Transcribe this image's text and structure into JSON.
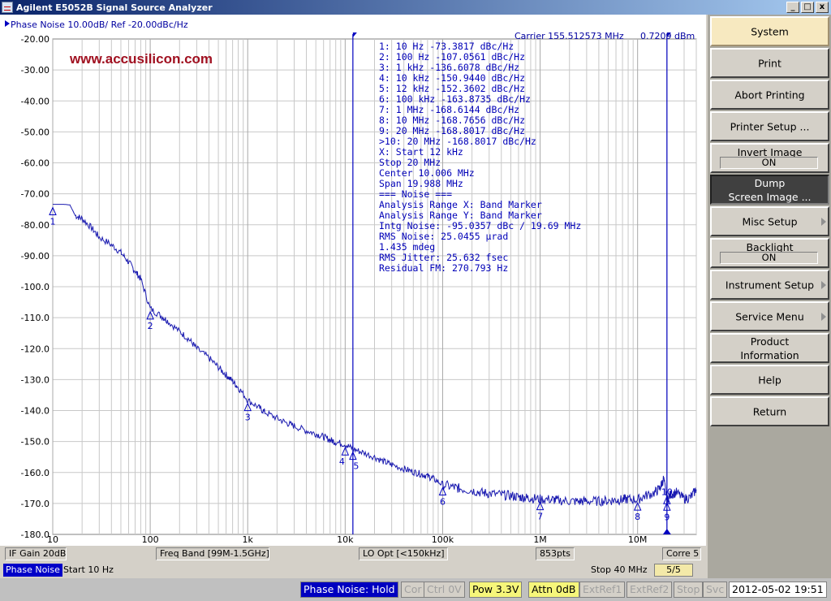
{
  "window": {
    "title": "Agilent E5052B Signal Source Analyzer",
    "buttons": [
      "_",
      "□",
      "x"
    ]
  },
  "trace": {
    "header": "Phase Noise 10.00dB/ Ref -20.00dBc/Hz",
    "carrier": "Carrier 155.512573 MHz",
    "carrier_power": "0.7209 dBm",
    "watermark": "www.accusilicon.com"
  },
  "markers_table": [
    "1:  10 Hz      -73.3817 dBc/Hz",
    "2:  100 Hz   -107.0561 dBc/Hz",
    "3:  1 kHz    -136.6078 dBc/Hz",
    "4:  10 kHz   -150.9440 dBc/Hz",
    "5:  12 kHz   -152.3602 dBc/Hz",
    "6:  100 kHz  -163.8735 dBc/Hz",
    "7:  1 MHz    -168.6144 dBc/Hz",
    "8:  10 MHz   -168.7656 dBc/Hz",
    "9:  20 MHz   -168.8017 dBc/Hz",
    ">10:  20 MHz  -168.8017 dBc/Hz"
  ],
  "analysis": [
    " X: Start 12 kHz",
    "      Stop 20 MHz",
    "   Center 10.006 MHz",
    "      Span 19.988 MHz",
    "=== Noise ===",
    "Analysis Range X: Band Marker",
    "Analysis Range Y: Band Marker",
    " Intg Noise: -95.0357 dBc / 19.69 MHz",
    "  RMS Noise: 25.0455 µrad",
    "               1.435 mdeg",
    "RMS Jitter: 25.632 fsec",
    "Residual FM: 270.793 Hz"
  ],
  "chart_data": {
    "type": "line",
    "title": "Phase Noise 10.00dB/ Ref -20.00dBc/Hz",
    "xscale": "log",
    "xlim": [
      10,
      40000000
    ],
    "ylim": [
      -180,
      -20
    ],
    "yticks": [
      "-20.00",
      "-30.00",
      "-40.00",
      "-50.00",
      "-60.00",
      "-70.00",
      "-80.00",
      "-90.00",
      "-100.0",
      "-110.0",
      "-120.0",
      "-130.0",
      "-140.0",
      "-150.0",
      "-160.0",
      "-170.0",
      "-180.0"
    ],
    "xtick_labels": [
      "10",
      "100",
      "1k",
      "10k",
      "100k",
      "1M",
      "10M"
    ],
    "xtick_values": [
      10,
      100,
      1000,
      10000,
      100000,
      1000000,
      10000000
    ],
    "series": [
      {
        "x": [
          10,
          13,
          15,
          17,
          20,
          25,
          30,
          40,
          50,
          60,
          70,
          80,
          100,
          130,
          150,
          200,
          250,
          300,
          400,
          500,
          600,
          700,
          800,
          1000,
          1300,
          1500,
          2000,
          2500,
          3000,
          4000,
          5000,
          6000,
          7000,
          8000,
          10000,
          12000,
          15000,
          20000,
          25000,
          30000,
          40000,
          50000,
          60000,
          70000,
          80000,
          100000,
          130000,
          150000,
          200000,
          250000,
          300000,
          400000,
          500000,
          600000,
          700000,
          800000,
          1000000,
          1300000,
          1500000,
          2000000,
          2500000,
          3000000,
          4000000,
          5000000,
          6000000,
          7000000,
          8000000,
          10000000,
          12000000,
          15000000,
          17000000,
          18500000,
          20000000,
          22000000,
          25000000,
          30000000,
          35000000,
          40000000
        ],
        "y": [
          -73.4,
          -73.4,
          -73.6,
          -77,
          -78,
          -81,
          -84,
          -86.5,
          -89,
          -92,
          -95,
          -97.5,
          -107.1,
          -109.5,
          -111,
          -114.5,
          -117,
          -120,
          -123,
          -126,
          -128.5,
          -130.5,
          -132.5,
          -136.6,
          -139,
          -140.5,
          -142.5,
          -144,
          -145,
          -146.5,
          -147.5,
          -148.5,
          -149.5,
          -150.2,
          -150.9,
          -152.4,
          -153.5,
          -155,
          -156.5,
          -157.5,
          -158.8,
          -159.8,
          -160.5,
          -161.2,
          -162,
          -163.9,
          -164.8,
          -165.2,
          -165.8,
          -166.5,
          -166.8,
          -167.2,
          -167.5,
          -167.9,
          -168.1,
          -168.3,
          -168.6,
          -168.7,
          -169,
          -169.2,
          -169.4,
          -169.2,
          -169.3,
          -169.1,
          -168.9,
          -168.8,
          -168.6,
          -168.8,
          -167.5,
          -166.5,
          -165,
          -162,
          -168.8,
          -167,
          -166.5,
          -168.5,
          -168,
          -165.5
        ]
      }
    ],
    "markers": [
      {
        "label": "1",
        "x": 10,
        "y": -73.3817
      },
      {
        "label": "2",
        "x": 100,
        "y": -107.0561
      },
      {
        "label": "3",
        "x": 1000,
        "y": -136.6078
      },
      {
        "label": "4",
        "x": 10000,
        "y": -150.944
      },
      {
        "label": "5",
        "x": 12000,
        "y": -152.3602
      },
      {
        "label": "6",
        "x": 100000,
        "y": -163.8735
      },
      {
        "label": "7",
        "x": 1000000,
        "y": -168.6144
      },
      {
        "label": "8",
        "x": 10000000,
        "y": -168.7656
      },
      {
        "label": "9",
        "x": 20000000,
        "y": -168.8017
      },
      {
        "label": "10",
        "x": 20000000,
        "y": -168.8017
      }
    ],
    "band_markers_x": [
      12000,
      20000000
    ],
    "grid": true,
    "colors": {
      "trace": "#1a1ab0",
      "marker": "#0000c0",
      "grid": "#c8c8c8",
      "axis_text": "#000000"
    }
  },
  "channel_status": {
    "if_gain": "IF Gain 20dB",
    "freq_band": "Freq Band [99M-1.5GHz]",
    "lo_opt": "LO Opt [<150kHz]",
    "points": "853pts",
    "corr": "Corre 5"
  },
  "sweep": {
    "channel": "Phase Noise",
    "start": "Start 10 Hz",
    "stop": "Stop 40 MHz",
    "page": "5/5"
  },
  "statusbar": {
    "mode": "Phase Noise: Hold",
    "cor": "Cor",
    "ctrl": "Ctrl   0V",
    "pow": "Pow   3.3V",
    "attn": "Attn 0dB",
    "extref1": "ExtRef1",
    "extref2": "ExtRef2",
    "stop": "Stop",
    "svc": "Svc",
    "datetime": "2012-05-02 19:51"
  },
  "softkeys": {
    "system": "System",
    "print": "Print",
    "abort": "Abort Printing",
    "printer_setup": "Printer Setup ...",
    "invert_image": "Invert Image",
    "invert_state": "ON",
    "dump_1": "Dump",
    "dump_2": "Screen Image ...",
    "misc": "Misc Setup",
    "backlight": "Backlight",
    "backlight_state": "ON",
    "instrument": "Instrument Setup",
    "service": "Service Menu",
    "product_1": "Product",
    "product_2": "Information",
    "help": "Help",
    "return": "Return"
  }
}
